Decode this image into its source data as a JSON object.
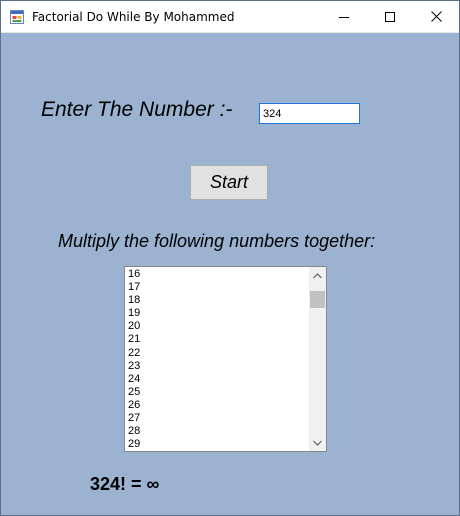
{
  "window": {
    "title": "Factorial Do While By Mohammed"
  },
  "titlebar_icons": {
    "app": "app-form-icon",
    "minimize": "minimize-icon",
    "maximize": "maximize-icon",
    "close": "close-icon"
  },
  "form": {
    "prompt_label": "Enter The Number :-",
    "number_value": "324",
    "start_label": "Start",
    "multiply_label": "Multiply the following numbers together:",
    "list_items": [
      "16",
      "17",
      "18",
      "19",
      "20",
      "21",
      "22",
      "23",
      "24",
      "25",
      "26",
      "27",
      "28",
      "29"
    ],
    "result": "324! = ∞"
  },
  "colors": {
    "form_background": "#9bb3d1",
    "input_focus_border": "#1e73d6",
    "button_background": "#e1e1e1"
  }
}
